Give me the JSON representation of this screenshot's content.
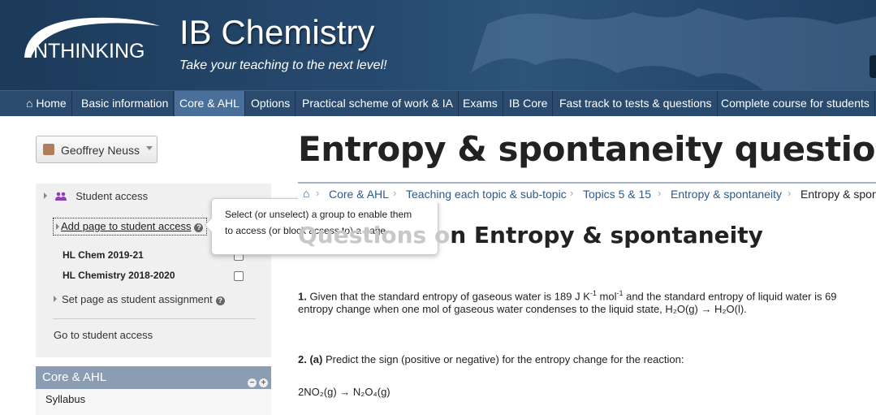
{
  "banner": {
    "logo_text": "INTHINKING",
    "title": "IB Chemistry",
    "tagline": "Take your teaching to the next level!"
  },
  "nav": {
    "items": [
      {
        "label": "Home",
        "icon": "home-icon"
      },
      {
        "label": "Basic information"
      },
      {
        "label": "Core & AHL",
        "active": true
      },
      {
        "label": "Options"
      },
      {
        "label": "Practical scheme of work & IA"
      },
      {
        "label": "Exams"
      },
      {
        "label": "IB Core"
      },
      {
        "label": "Fast track to tests & questions"
      },
      {
        "label": "Complete course for students"
      }
    ]
  },
  "user": {
    "name": "Geoffrey Neuss"
  },
  "student_access": {
    "heading": "Student access",
    "add_page": "Add page to student access",
    "groups": [
      {
        "label": "HL Chem 2019-21",
        "checked": false
      },
      {
        "label": "HL Chemistry 2018-2020",
        "checked": false
      }
    ],
    "set_assignment": "Set page as student assignment",
    "go_to": "Go to student access"
  },
  "tooltip": {
    "line1": "Select (or unselect) a group to enable them",
    "line2": "to access (or block access to) a page"
  },
  "panel": {
    "title": "Core & AHL",
    "first_item": "Syllabus"
  },
  "page": {
    "title": "Entropy & spontaneity questions",
    "breadcrumb": [
      "Core & AHL",
      "Teaching each topic & sub-topic",
      "Topics 5 & 15",
      "Entropy & spontaneity",
      "Entropy & spon"
    ],
    "section_faded": "Questions o",
    "section_rest": "n Entropy & spontaneity",
    "q1_num": "1.",
    "q1_a": " Given that the standard entropy of gaseous water is 189 J K",
    "q1_b": " mol",
    "q1_c": " and the standard entropy of liquid water is 69",
    "q1_line2": "entropy change when one mol of gaseous water condenses to the liquid state, H₂O(g) → H₂O(l).",
    "q2_num": "2. (a)",
    "q2_text": " Predict the sign (positive or negative) for the entropy change for the reaction:",
    "reaction": "2NO₂(g) → N₂O₄(g)"
  },
  "colors": {
    "banner": "#274b70",
    "nav": "#2a4a6e",
    "nav_active": "#4a6f99",
    "link": "#2a5b8f",
    "panel_head": "#8a9db3"
  }
}
